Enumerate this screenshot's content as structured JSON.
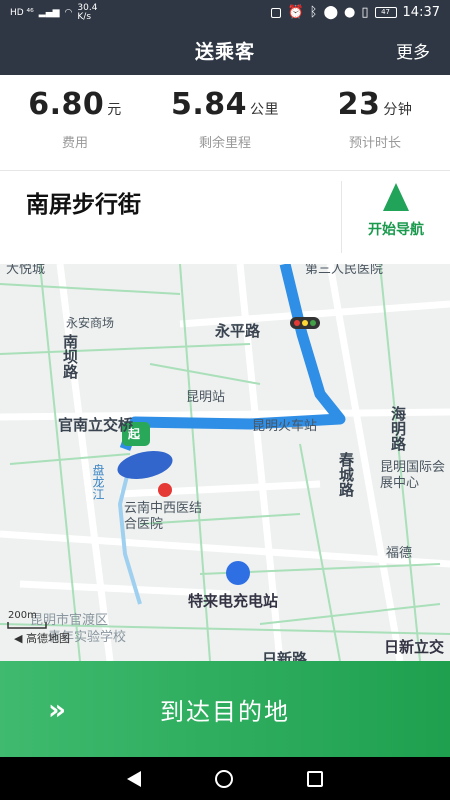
{
  "status_bar": {
    "carrier_badges": "HD ⁴⁶",
    "net_speed": "30.4 K/s",
    "battery": "47",
    "time": "14:37"
  },
  "header": {
    "title": "送乘客",
    "more_label": "更多"
  },
  "stats": {
    "fee": {
      "value": "6.80",
      "unit": "元",
      "label": "费用"
    },
    "distance": {
      "value": "5.84",
      "unit": "公里",
      "label": "剩余里程"
    },
    "duration": {
      "value": "23",
      "unit": "分钟",
      "label": "预计时长"
    }
  },
  "destination": {
    "name": "南屏步行街",
    "nav_label": "开始导航"
  },
  "map": {
    "labels": {
      "dayuecheng": "大悦城",
      "renminhospital": "第三人民医院",
      "yongan": "永安商场",
      "yongping": "永平路",
      "nanba": "南坝路",
      "kunming_station": "昆明站",
      "guannan": "官南立交桥",
      "kunming_rail": "昆明火车站",
      "haiming": "海明路",
      "chuncheng": "春城路",
      "expo": "昆明国际会展中心",
      "panlong": "盘龙江",
      "tcm": "云南中西医结合医院",
      "fude": "福德",
      "charging": "特来电充电站",
      "school": "昆明市官渡区",
      "school2": "青年实验学校",
      "rixin": "日新路",
      "rixin_jct": "日新立交",
      "start_marker": "起",
      "scale": "200m",
      "brand": "高德地图"
    }
  },
  "footer": {
    "arrive_label": "到达目的地"
  }
}
